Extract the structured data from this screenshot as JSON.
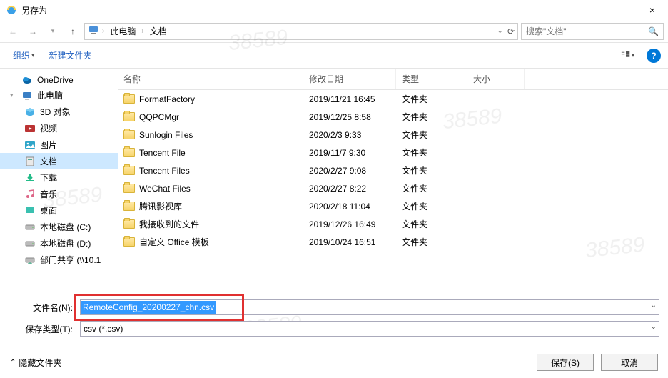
{
  "window": {
    "title": "另存为",
    "close": "×"
  },
  "nav": {
    "back_enabled": false,
    "forward_enabled": false,
    "breadcrumb": [
      "此电脑",
      "文档"
    ],
    "refresh": "↻",
    "search_placeholder": "搜索\"文档\""
  },
  "toolbar": {
    "organize": "组织",
    "new_folder": "新建文件夹",
    "help": "?"
  },
  "sidebar": [
    {
      "icon": "onedrive",
      "label": "OneDrive",
      "level": 0,
      "expandable": false
    },
    {
      "icon": "thispc",
      "label": "此电脑",
      "level": 0,
      "expandable": true
    },
    {
      "icon": "3d",
      "label": "3D 对象",
      "level": 1
    },
    {
      "icon": "video",
      "label": "视频",
      "level": 1
    },
    {
      "icon": "pictures",
      "label": "图片",
      "level": 1
    },
    {
      "icon": "docs",
      "label": "文档",
      "level": 1,
      "selected": true
    },
    {
      "icon": "download",
      "label": "下载",
      "level": 1
    },
    {
      "icon": "music",
      "label": "音乐",
      "level": 1
    },
    {
      "icon": "desktop",
      "label": "桌面",
      "level": 1
    },
    {
      "icon": "disk",
      "label": "本地磁盘 (C:)",
      "level": 1
    },
    {
      "icon": "disk",
      "label": "本地磁盘 (D:)",
      "level": 1
    },
    {
      "icon": "netdisk",
      "label": "部门共享 (\\\\10.1",
      "level": 1
    }
  ],
  "columns": {
    "name": "名称",
    "date": "修改日期",
    "type": "类型",
    "size": "大小"
  },
  "files": [
    {
      "name": "FormatFactory",
      "date": "2019/11/21 16:45",
      "type": "文件夹"
    },
    {
      "name": "QQPCMgr",
      "date": "2019/12/25 8:58",
      "type": "文件夹"
    },
    {
      "name": "Sunlogin Files",
      "date": "2020/2/3 9:33",
      "type": "文件夹"
    },
    {
      "name": "Tencent File",
      "date": "2019/11/7 9:30",
      "type": "文件夹"
    },
    {
      "name": "Tencent Files",
      "date": "2020/2/27 9:08",
      "type": "文件夹"
    },
    {
      "name": "WeChat Files",
      "date": "2020/2/27 8:22",
      "type": "文件夹"
    },
    {
      "name": "腾讯影视库",
      "date": "2020/2/18 11:04",
      "type": "文件夹"
    },
    {
      "name": "我接收到的文件",
      "date": "2019/12/26 16:49",
      "type": "文件夹"
    },
    {
      "name": "自定义 Office 模板",
      "date": "2019/10/24 16:51",
      "type": "文件夹"
    }
  ],
  "fields": {
    "filename_label": "文件名(N):",
    "filename_value": "RemoteConfig_20200227_chn.csv",
    "filetype_label": "保存类型(T):",
    "filetype_value": "csv (*.csv)"
  },
  "footer": {
    "hide_folders": "隐藏文件夹",
    "save": "保存(S)",
    "cancel": "取消"
  },
  "watermark": "38589"
}
